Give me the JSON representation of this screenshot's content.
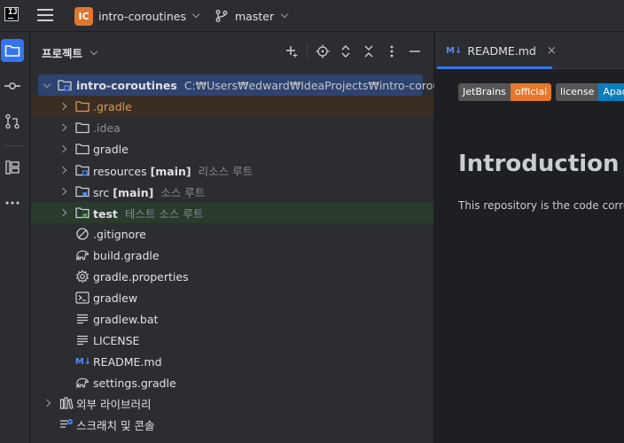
{
  "titlebar": {
    "project_badge": "IC",
    "project_name": "intro-coroutines",
    "branch_name": "master"
  },
  "toolstrip": {
    "items": [
      "project-icon",
      "commit-icon",
      "pull-requests-icon",
      "structure-icon",
      "more-icon"
    ]
  },
  "project_panel": {
    "title": "프로젝트",
    "root": {
      "name": "intro-coroutines",
      "path": "C:₩Users₩edward₩IdeaProjects₩intro-coroutines"
    },
    "items": [
      {
        "name": ".gradle",
        "type": "folder-excluded"
      },
      {
        "name": ".idea",
        "type": "folder"
      },
      {
        "name": "gradle",
        "type": "folder"
      },
      {
        "name": "resources",
        "tag": "[main]",
        "hint": "리소스 루트",
        "type": "resources-root"
      },
      {
        "name": "src",
        "tag": "[main]",
        "hint": "소스 루트",
        "type": "source-root"
      },
      {
        "name": "test",
        "hint": "테스트 소스 루트",
        "type": "test-root"
      },
      {
        "name": ".gitignore",
        "type": "ignore-file"
      },
      {
        "name": "build.gradle",
        "type": "gradle-file"
      },
      {
        "name": "gradle.properties",
        "type": "properties-file"
      },
      {
        "name": "gradlew",
        "type": "shell-file"
      },
      {
        "name": "gradlew.bat",
        "type": "text-file"
      },
      {
        "name": "LICENSE",
        "type": "text-file"
      },
      {
        "name": "README.md",
        "type": "markdown-file"
      },
      {
        "name": "settings.gradle",
        "type": "gradle-file"
      }
    ],
    "external_libraries": "외부 라이브러리",
    "scratches": "스크래치 및 콘솔"
  },
  "editor": {
    "tab_icon": "M↓",
    "tab_label": "README.md",
    "badges": [
      {
        "left": "JetBrains",
        "right": "official",
        "right_color": "#e8782a"
      },
      {
        "left": "license",
        "right": "Apac",
        "right_color": "#0c7ebc"
      }
    ],
    "heading": "Introduction to",
    "paragraph": "This repository is the code corres"
  },
  "colors": {
    "accent": "#3574f0",
    "selection": "#2e436e",
    "excluded_bg": "#3a2e24",
    "test_bg": "#2a3a2c",
    "project_badge": "#e0772f"
  }
}
